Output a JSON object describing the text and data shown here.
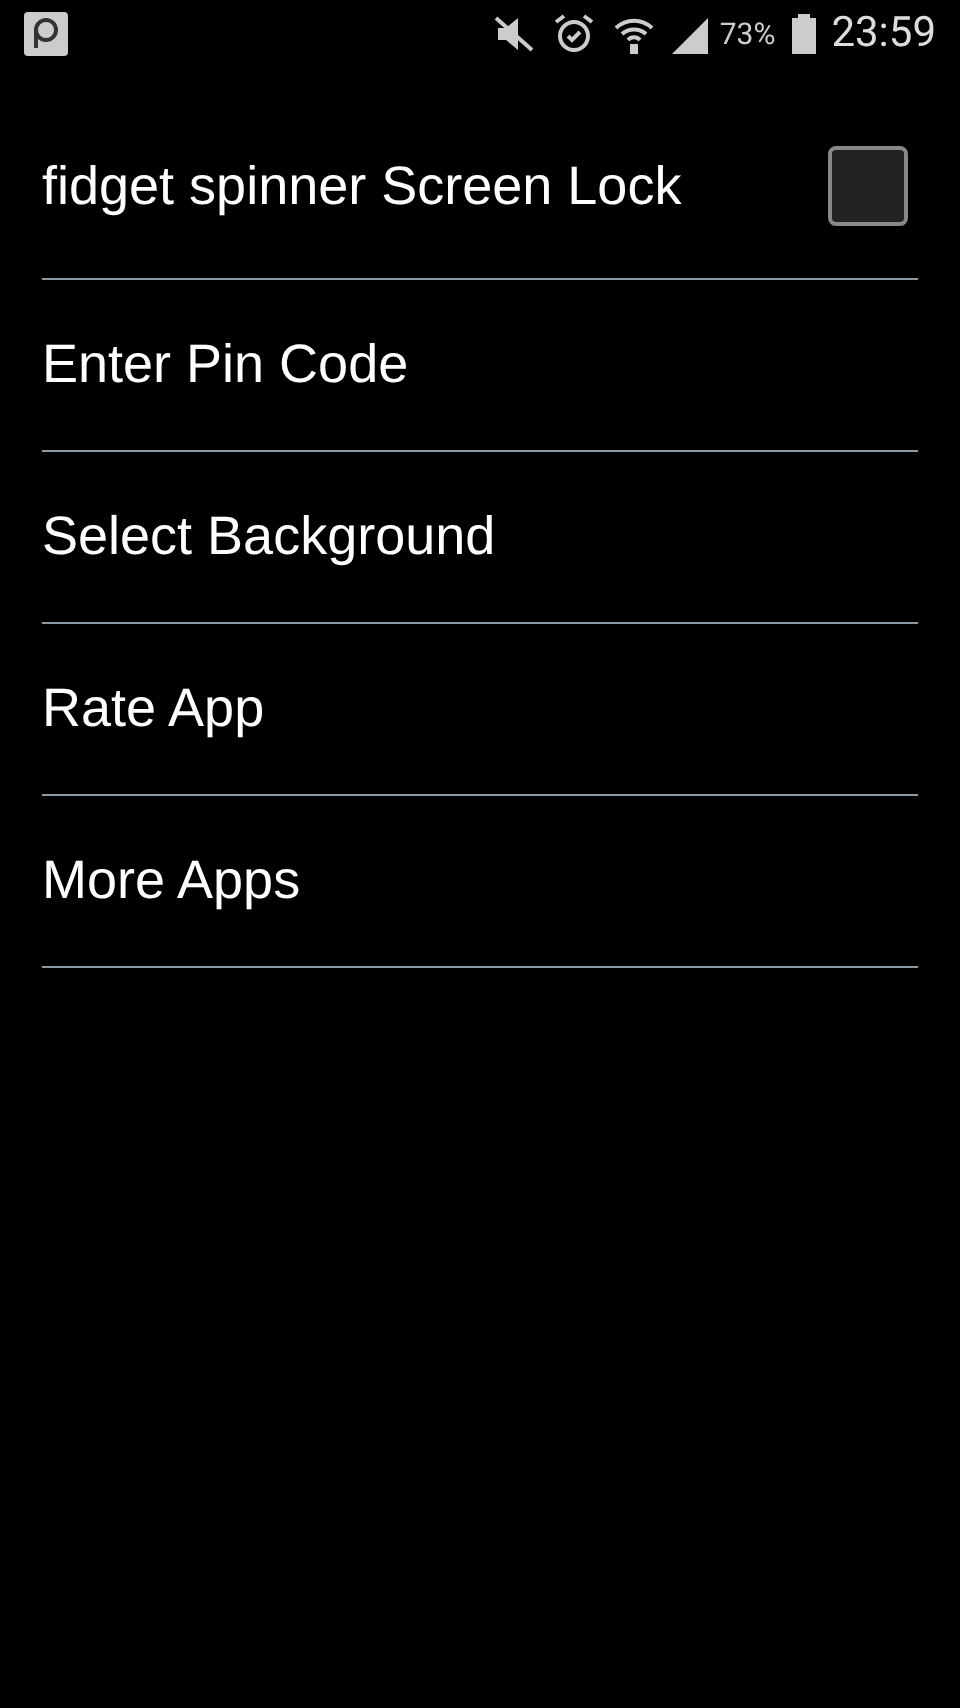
{
  "status_bar": {
    "battery": "73%",
    "time": "23:59"
  },
  "settings": [
    {
      "kind": "checkbox",
      "label": "fidget spinner Screen Lock",
      "checked": false
    },
    {
      "kind": "plain",
      "label": "Enter Pin Code"
    },
    {
      "kind": "plain",
      "label": "Select Background"
    },
    {
      "kind": "plain",
      "label": "Rate App"
    },
    {
      "kind": "plain",
      "label": "More Apps"
    }
  ]
}
